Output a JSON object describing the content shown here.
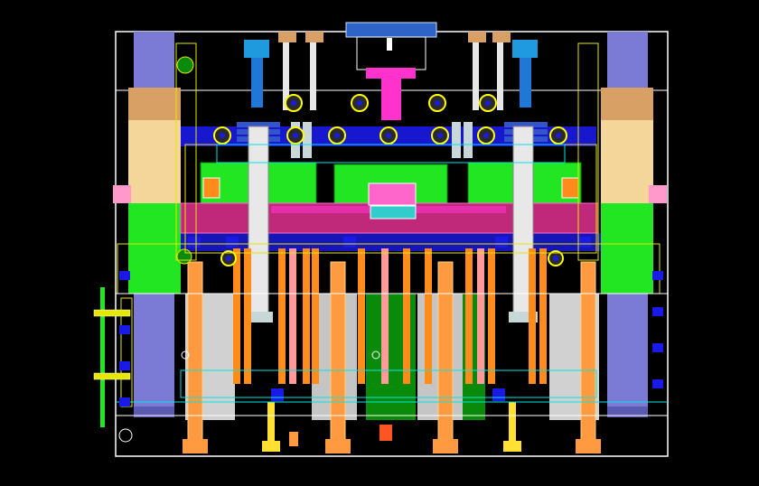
{
  "view": {
    "background": "#000000",
    "palette": {
      "frame": "#ffffff",
      "outline_yellow": "#e6e600",
      "outline_cyan": "#00e5e5",
      "leader_pillar": "#7b7bd6",
      "bushing_tan": "#d9a066",
      "bushing_light": "#f5d69a",
      "plate_green": "#22e622",
      "plate_magenta": "#c0287a",
      "ejector_orange": "#ff8c1a",
      "ejector_pink": "#ff9a9a",
      "sprue_magenta": "#ff33cc",
      "bolt_blue": "#1f78d8",
      "steel_white": "#e8e8e8",
      "steel_gray": "#c8d8d8",
      "nut_yellow": "#ffff00",
      "deep_blue": "#1a1ae6",
      "dark_green": "#0a8a0a"
    },
    "icons": [
      "mold-assembly-cad-section",
      "hex-nut-icon",
      "sprue-bushing-icon",
      "guide-pillar-icon",
      "ejector-pin-icon"
    ]
  }
}
